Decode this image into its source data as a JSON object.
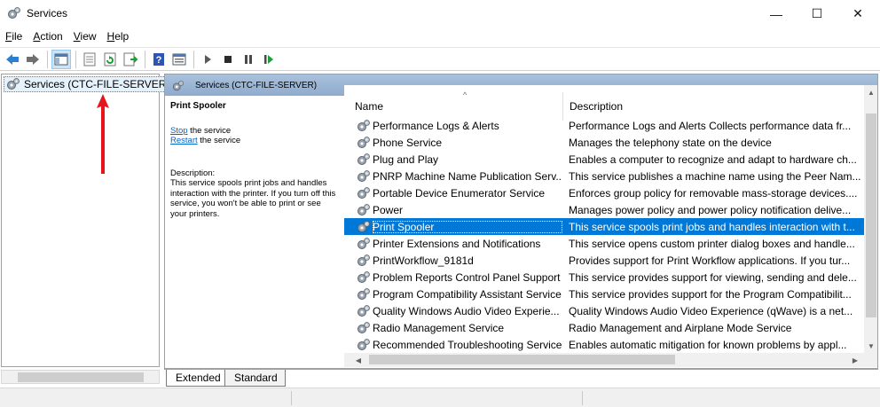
{
  "window": {
    "title": "Services",
    "minimize_glyph": "—",
    "maximize_glyph": "☐",
    "close_glyph": "✕",
    "icon": "services-gear-icon"
  },
  "menubar": {
    "items": [
      {
        "label": "File",
        "accel": "F",
        "rest": "ile"
      },
      {
        "label": "Action",
        "accel": "A",
        "rest": "ction"
      },
      {
        "label": "View",
        "accel": "V",
        "rest": "iew"
      },
      {
        "label": "Help",
        "accel": "H",
        "rest": "elp"
      }
    ]
  },
  "toolbar": {
    "icons": [
      "back-arrow-icon",
      "forward-arrow-icon",
      "show-hide-console-tree-icon",
      "properties-icon",
      "refresh-icon",
      "export-list-icon",
      "help-icon",
      "show-hide-action-pane-icon",
      "start-service-icon",
      "stop-service-icon",
      "pause-service-icon",
      "restart-service-icon"
    ],
    "colors": {
      "back": "#2f7fd1",
      "forward": "#6f6f6f",
      "play": "#4a4a4a",
      "restart": "#1f9e3c"
    }
  },
  "tree": {
    "root_label": "Services (CTC-FILE-SERVER)"
  },
  "annotation": {
    "arrow_color": "#e8141c"
  },
  "main": {
    "header_title": "Services (CTC-FILE-SERVER)",
    "header_color": "#9ab4d4",
    "details": {
      "service_name": "Print Spooler",
      "stop_link": "Stop",
      "stop_rest": " the service",
      "restart_link": "Restart",
      "restart_rest": " the service",
      "description_label": "Description:",
      "description_text": "This service spools print jobs and handles interaction with the printer.  If you turn off this service, you won't be able to print or see your printers."
    },
    "columns": {
      "name": "Name",
      "description": "Description"
    },
    "rows": [
      {
        "name": "Performance Logs & Alerts",
        "description": "Performance Logs and Alerts Collects performance data fr...",
        "selected": false
      },
      {
        "name": "Phone Service",
        "description": "Manages the telephony state on the device",
        "selected": false
      },
      {
        "name": "Plug and Play",
        "description": "Enables a computer to recognize and adapt to hardware ch...",
        "selected": false
      },
      {
        "name": "PNRP Machine Name Publication Serv...",
        "description": "This service publishes a machine name using the Peer Nam...",
        "selected": false
      },
      {
        "name": "Portable Device Enumerator Service",
        "description": "Enforces group policy for removable mass-storage devices....",
        "selected": false
      },
      {
        "name": "Power",
        "description": "Manages power policy and power policy notification delive...",
        "selected": false
      },
      {
        "name": "Print Spooler",
        "description": "This service spools print jobs and handles interaction with t...",
        "selected": true
      },
      {
        "name": "Printer Extensions and Notifications",
        "description": "This service opens custom printer dialog boxes and handle...",
        "selected": false
      },
      {
        "name": "PrintWorkflow_9181d",
        "description": "Provides support for Print Workflow applications. If you tur...",
        "selected": false
      },
      {
        "name": "Problem Reports Control Panel Support",
        "description": "This service provides support for viewing, sending and dele...",
        "selected": false
      },
      {
        "name": "Program Compatibility Assistant Service",
        "description": "This service provides support for the Program Compatibilit...",
        "selected": false
      },
      {
        "name": "Quality Windows Audio Video Experie...",
        "description": "Quality Windows Audio Video Experience (qWave) is a net...",
        "selected": false
      },
      {
        "name": "Radio Management Service",
        "description": "Radio Management and Airplane Mode Service",
        "selected": false
      },
      {
        "name": "Recommended Troubleshooting Service",
        "description": "Enables automatic mitigation for known problems by appl...",
        "selected": false
      }
    ]
  },
  "tabs": {
    "extended": "Extended",
    "standard": "Standard"
  }
}
